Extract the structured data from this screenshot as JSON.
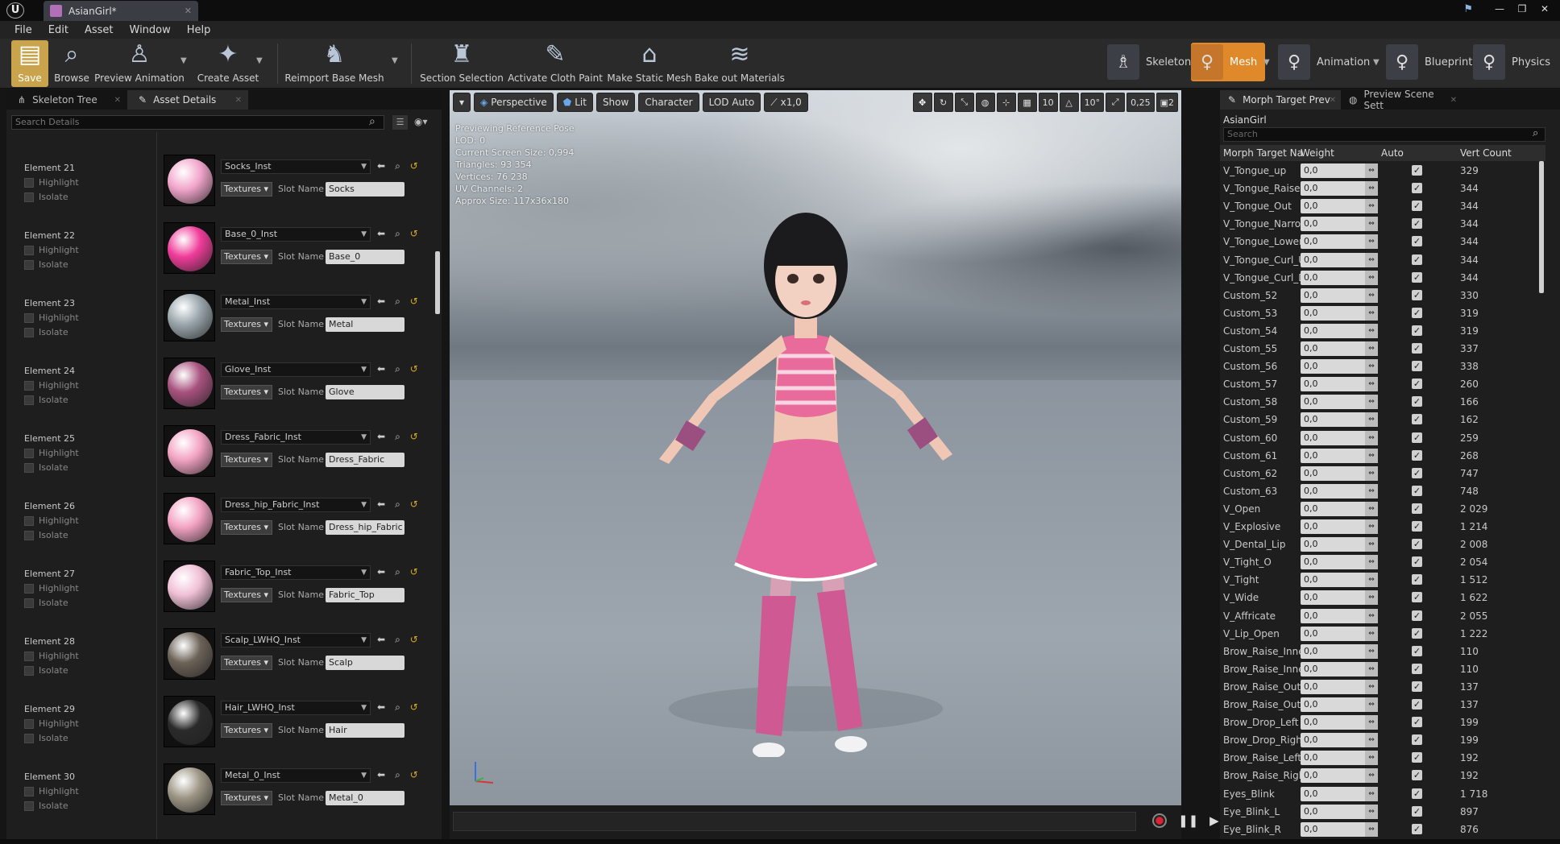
{
  "window": {
    "tab_title": "AsianGirl*",
    "controls": [
      "—",
      "❐",
      "✕"
    ]
  },
  "menu": [
    "File",
    "Edit",
    "Asset",
    "Window",
    "Help"
  ],
  "toolbar": {
    "buttons": [
      {
        "label": "Save",
        "icon": "save-icon"
      },
      {
        "label": "Browse",
        "icon": "browse-icon"
      },
      {
        "label": "Preview Animation",
        "icon": "preview-animation-icon"
      },
      {
        "label": "Create Asset",
        "icon": "create-asset-icon"
      },
      {
        "label": "Reimport Base Mesh",
        "icon": "reimport-icon"
      },
      {
        "label": "Section Selection",
        "icon": "section-selection-icon"
      },
      {
        "label": "Activate Cloth Paint",
        "icon": "cloth-paint-icon"
      },
      {
        "label": "Make Static Mesh",
        "icon": "static-mesh-icon"
      },
      {
        "label": "Bake out Materials",
        "icon": "bake-materials-icon"
      }
    ],
    "modes": [
      {
        "label": "Skeleton"
      },
      {
        "label": "Mesh",
        "active": true
      },
      {
        "label": "Animation"
      },
      {
        "label": "Blueprint"
      },
      {
        "label": "Physics"
      }
    ]
  },
  "left_panel": {
    "tabs": [
      "Skeleton Tree",
      "Asset Details"
    ],
    "search_placeholder": "Search Details",
    "highlight_label": "Highlight",
    "isolate_label": "Isolate",
    "textures_label": "Textures",
    "slot_label": "Slot Name",
    "elements": [
      {
        "label": "Element 21",
        "material": "Socks_Inst",
        "slot": "Socks",
        "color": "#f2a6cc"
      },
      {
        "label": "Element 22",
        "material": "Base_0_Inst",
        "slot": "Base_0",
        "color": "#f03c9a"
      },
      {
        "label": "Element 23",
        "material": "Metal_Inst",
        "slot": "Metal",
        "color": "#9aa6ac"
      },
      {
        "label": "Element 24",
        "material": "Glove_Inst",
        "slot": "Glove",
        "color": "#a8527f"
      },
      {
        "label": "Element 25",
        "material": "Dress_Fabric_Inst",
        "slot": "Dress_Fabric",
        "color": "#f3a3c3"
      },
      {
        "label": "Element 26",
        "material": "Dress_hip_Fabric_Inst",
        "slot": "Dress_hip_Fabric",
        "color": "#f3a3c3"
      },
      {
        "label": "Element 27",
        "material": "Fabric_Top_Inst",
        "slot": "Fabric_Top",
        "color": "#f0c0d6"
      },
      {
        "label": "Element 28",
        "material": "Scalp_LWHQ_Inst",
        "slot": "Scalp",
        "color": "#6c6258"
      },
      {
        "label": "Element 29",
        "material": "Hair_LWHQ_Inst",
        "slot": "Hair",
        "color": "#2a2a2a"
      },
      {
        "label": "Element 30",
        "material": "Metal_0_Inst",
        "slot": "Metal_0",
        "color": "#9c9584"
      }
    ]
  },
  "viewport": {
    "perspective_label": "Perspective",
    "lit_label": "Lit",
    "show_label": "Show",
    "character_label": "Character",
    "lod_label": "LOD Auto",
    "speed_label": "x1,0",
    "grid_snap": "10",
    "angle_snap": "10°",
    "scale_snap": "0,25",
    "camera_speed": "2",
    "stats": [
      "Previewing Reference Pose",
      "LOD: 0",
      "Current Screen Size: 0,994",
      "Triangles: 93 354",
      "Vertices: 76 238",
      "UV Channels: 2",
      "Approx Size: 117x36x180"
    ]
  },
  "right_panel": {
    "tabs": [
      "Morph Target Prev",
      "Preview Scene Sett"
    ],
    "asset_name": "AsianGirl",
    "search_placeholder": "Search",
    "columns": [
      "Morph Target Na",
      "Weight",
      "Auto",
      "Vert Count"
    ],
    "rows": [
      {
        "name": "V_Tongue_up",
        "weight": "0,0",
        "count": "329"
      },
      {
        "name": "V_Tongue_Raise",
        "weight": "0,0",
        "count": "344"
      },
      {
        "name": "V_Tongue_Out",
        "weight": "0,0",
        "count": "344"
      },
      {
        "name": "V_Tongue_Narrow",
        "weight": "0,0",
        "count": "344"
      },
      {
        "name": "V_Tongue_Lower",
        "weight": "0,0",
        "count": "344"
      },
      {
        "name": "V_Tongue_Curl_U",
        "weight": "0,0",
        "count": "344"
      },
      {
        "name": "V_Tongue_Curl_D",
        "weight": "0,0",
        "count": "344"
      },
      {
        "name": "Custom_52",
        "weight": "0,0",
        "count": "330"
      },
      {
        "name": "Custom_53",
        "weight": "0,0",
        "count": "319"
      },
      {
        "name": "Custom_54",
        "weight": "0,0",
        "count": "319"
      },
      {
        "name": "Custom_55",
        "weight": "0,0",
        "count": "337"
      },
      {
        "name": "Custom_56",
        "weight": "0,0",
        "count": "338"
      },
      {
        "name": "Custom_57",
        "weight": "0,0",
        "count": "260"
      },
      {
        "name": "Custom_58",
        "weight": "0,0",
        "count": "166"
      },
      {
        "name": "Custom_59",
        "weight": "0,0",
        "count": "162"
      },
      {
        "name": "Custom_60",
        "weight": "0,0",
        "count": "259"
      },
      {
        "name": "Custom_61",
        "weight": "0,0",
        "count": "268"
      },
      {
        "name": "Custom_62",
        "weight": "0,0",
        "count": "747"
      },
      {
        "name": "Custom_63",
        "weight": "0,0",
        "count": "748"
      },
      {
        "name": "V_Open",
        "weight": "0,0",
        "count": "2 029"
      },
      {
        "name": "V_Explosive",
        "weight": "0,0",
        "count": "1 214"
      },
      {
        "name": "V_Dental_Lip",
        "weight": "0,0",
        "count": "2 008"
      },
      {
        "name": "V_Tight_O",
        "weight": "0,0",
        "count": "2 054"
      },
      {
        "name": "V_Tight",
        "weight": "0,0",
        "count": "1 512"
      },
      {
        "name": "V_Wide",
        "weight": "0,0",
        "count": "1 622"
      },
      {
        "name": "V_Affricate",
        "weight": "0,0",
        "count": "2 055"
      },
      {
        "name": "V_Lip_Open",
        "weight": "0,0",
        "count": "1 222"
      },
      {
        "name": "Brow_Raise_Inner",
        "weight": "0,0",
        "count": "110"
      },
      {
        "name": "Brow_Raise_Inner",
        "weight": "0,0",
        "count": "110"
      },
      {
        "name": "Brow_Raise_Outer",
        "weight": "0,0",
        "count": "137"
      },
      {
        "name": "Brow_Raise_Outer",
        "weight": "0,0",
        "count": "137"
      },
      {
        "name": "Brow_Drop_Left",
        "weight": "0,0",
        "count": "199"
      },
      {
        "name": "Brow_Drop_Right",
        "weight": "0,0",
        "count": "199"
      },
      {
        "name": "Brow_Raise_Left",
        "weight": "0,0",
        "count": "192"
      },
      {
        "name": "Brow_Raise_Right",
        "weight": "0,0",
        "count": "192"
      },
      {
        "name": "Eyes_Blink",
        "weight": "0,0",
        "count": "1 718"
      },
      {
        "name": "Eye_Blink_L",
        "weight": "0,0",
        "count": "897"
      },
      {
        "name": "Eye_Blink_R",
        "weight": "0,0",
        "count": "876"
      }
    ]
  },
  "colors": {
    "accent": "#e0892a",
    "save": "#caa44c",
    "pink": "#e8559a"
  }
}
